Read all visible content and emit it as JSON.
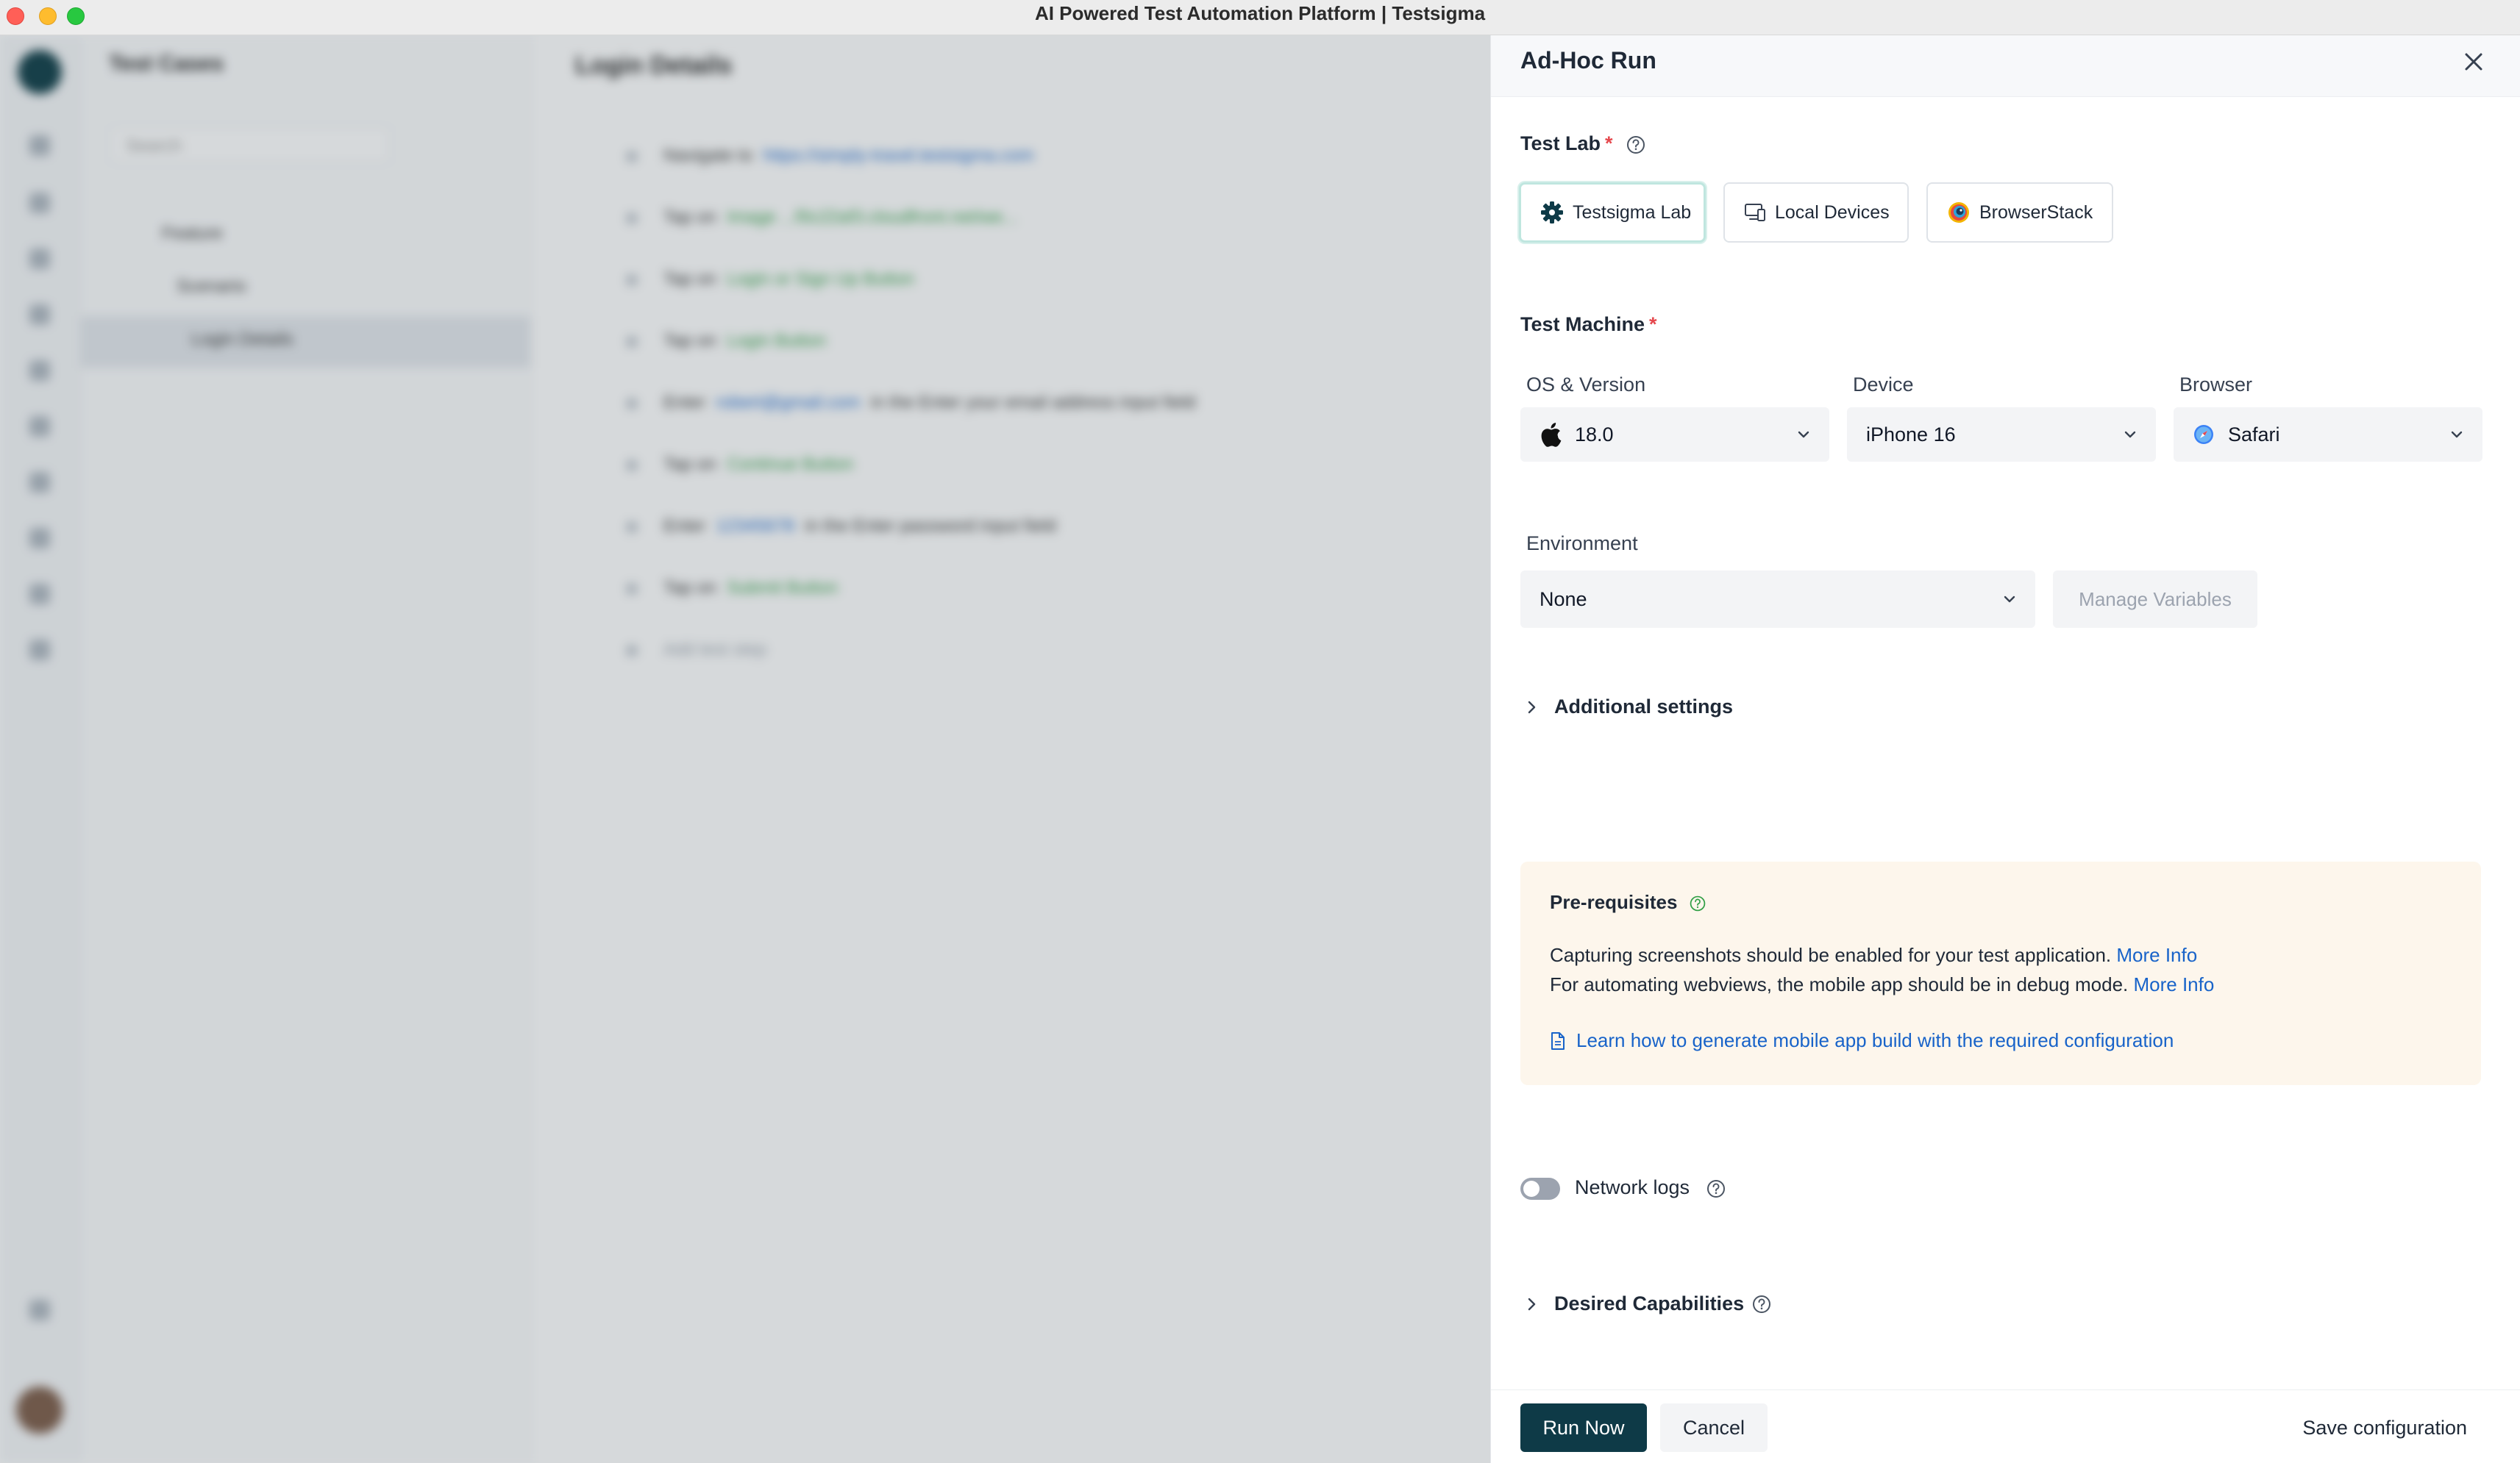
{
  "window": {
    "title": "AI Powered Test Automation Platform | Testsigma"
  },
  "background": {
    "tree_title": "Test Cases",
    "search_placeholder": "Search",
    "tree_nodes": [
      "Feature",
      "Scenario",
      "Login Details"
    ],
    "main_title": "Login Details",
    "steps": [
      {
        "action": "Navigate to",
        "value": "https://simply-travel.testsigma.com",
        "suffix": ""
      },
      {
        "action": "Tap on",
        "value": "Image ...f0c22af3.cloudfront.net/we...",
        "suffix": ""
      },
      {
        "action": "Tap on",
        "value": "Login or Sign Up Button",
        "suffix": ""
      },
      {
        "action": "Tap on",
        "value": "Login Button",
        "suffix": ""
      },
      {
        "action": "Enter",
        "value": "robert@gmail.com",
        "suffix": "in the  Enter your email address input  field"
      },
      {
        "action": "Tap on",
        "value": "Continue Button",
        "suffix": ""
      },
      {
        "action": "Enter",
        "value": "12345678",
        "suffix": "in the  Enter password input  field"
      },
      {
        "action": "Tap on",
        "value": "Submit Button",
        "suffix": ""
      },
      {
        "action": "Add test step",
        "value": "",
        "suffix": ""
      }
    ]
  },
  "drawer": {
    "title": "Ad-Hoc Run",
    "test_lab": {
      "label": "Test Lab",
      "required_mark": "*",
      "options": [
        {
          "label": "Testsigma Lab",
          "icon": "gear-icon",
          "selected": true
        },
        {
          "label": "Local Devices",
          "icon": "devices-icon",
          "selected": false
        },
        {
          "label": "BrowserStack",
          "icon": "browserstack-icon",
          "selected": false
        }
      ]
    },
    "test_machine": {
      "label": "Test Machine",
      "required_mark": "*",
      "os_label": "OS & Version",
      "os_value": "18.0",
      "device_label": "Device",
      "device_value": "iPhone 16",
      "browser_label": "Browser",
      "browser_value": "Safari"
    },
    "environment": {
      "label": "Environment",
      "value": "None",
      "manage_label": "Manage Variables"
    },
    "additional_settings": "Additional settings",
    "prerequisites": {
      "title": "Pre-requisites",
      "line1": "Capturing screenshots should be enabled for your test application.",
      "line2": "For automating webviews, the mobile app should be in debug mode.",
      "more_info": "More Info",
      "doc_link": "Learn how to generate mobile app build with the required configuration"
    },
    "network_logs": {
      "label": "Network logs",
      "enabled": false
    },
    "desired_capabilities": "Desired Capabilities",
    "footer": {
      "run_now": "Run Now",
      "cancel": "Cancel",
      "save_configuration": "Save configuration"
    }
  },
  "colors": {
    "primary": "#0e3a47",
    "link": "#1863c9",
    "required": "#e5484d",
    "prereq_bg": "#fdf6ec"
  }
}
